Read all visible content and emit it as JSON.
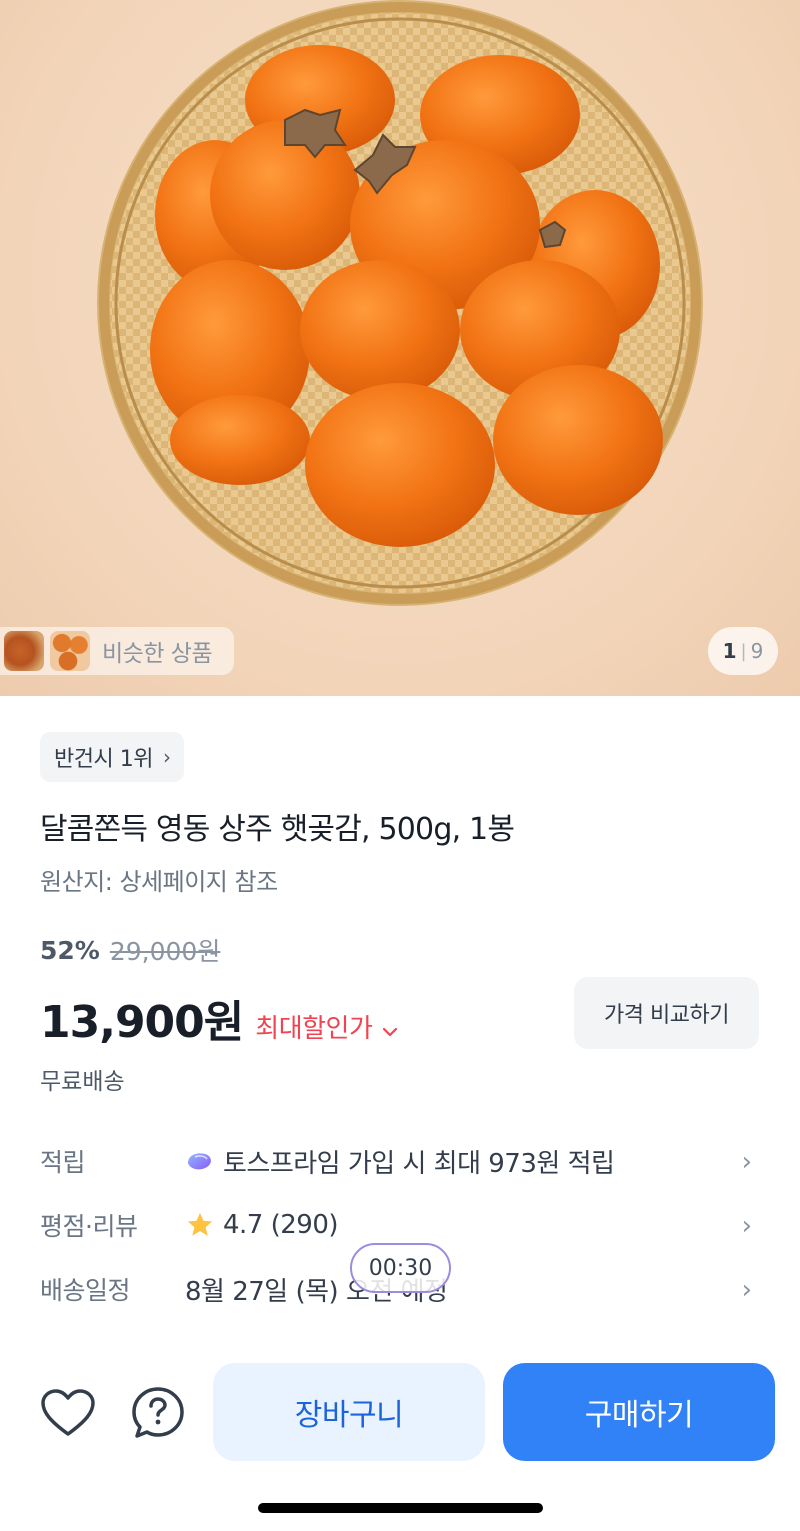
{
  "gallery": {
    "similar_label": "비슷한 상품",
    "current_page": "1",
    "separator": "|",
    "total_pages": "9"
  },
  "product": {
    "rank_badge": "반건시 1위",
    "title": "달콤쫀득 영동 상주 햇곶감, 500g, 1봉",
    "origin": "원산지: 상세페이지 참조",
    "discount_rate": "52%",
    "original_price": "29,000원",
    "price": "13,900원",
    "max_discount_label": "최대할인가",
    "compare_button": "가격 비교하기",
    "shipping": "무료배송"
  },
  "info_rows": {
    "points_label": "적립",
    "points_value": "토스프라임 가입 시 최대 973원 적립",
    "rating_label": "평점·리뷰",
    "rating_value": "4.7 (290)",
    "delivery_label": "배송일정",
    "delivery_value": "8월 27일 (목) 오전 예정"
  },
  "timer": "00:30",
  "bottom_bar": {
    "cart_label": "장바구니",
    "buy_label": "구매하기"
  },
  "colors": {
    "accent": "#3182f6",
    "sale_red": "#f04452",
    "star": "#ffc342",
    "cart_bg": "#e8f3ff"
  },
  "icons": {
    "heart": "heart-icon",
    "help": "question-icon",
    "points": "toss-prime-icon",
    "star": "star-icon"
  }
}
